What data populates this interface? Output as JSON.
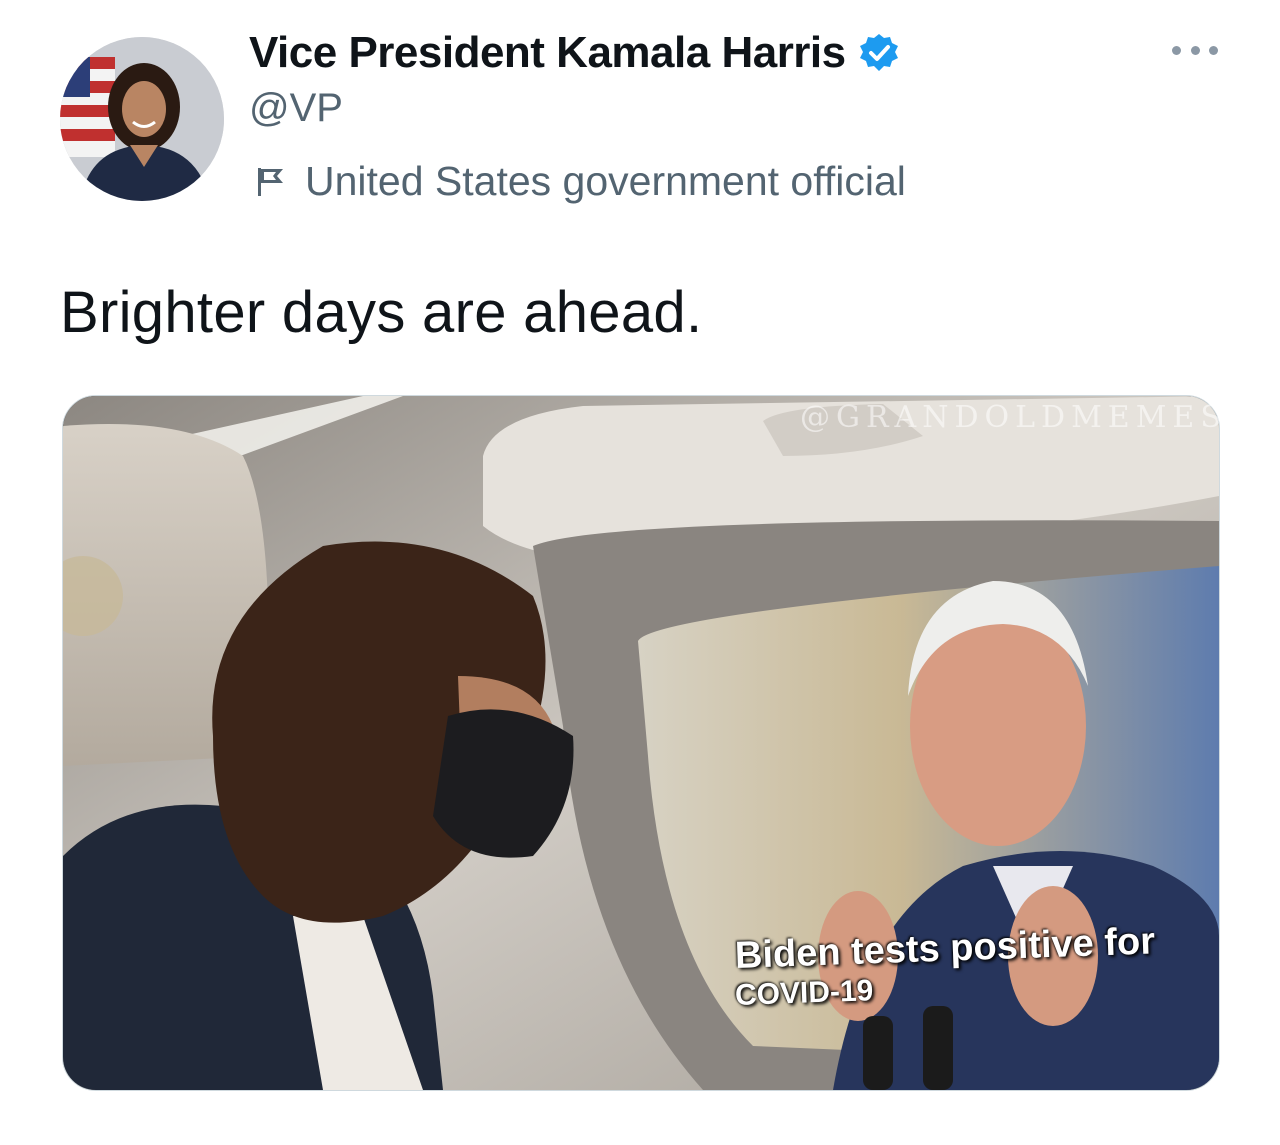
{
  "tweet": {
    "author": {
      "display_name": "Vice President Kamala Harris",
      "handle": "@VP",
      "verified": true,
      "verified_icon": "verified-badge-icon",
      "account_label": "United States government official",
      "label_icon": "flag-icon",
      "avatar_icon": "profile-avatar"
    },
    "more_icon": "more-options-icon",
    "text": "Brighter days are ahead.",
    "media": {
      "watermark": "@GRANDOLDMEMES",
      "caption_line1": "Biden tests positive for",
      "caption_line2": "COVID-19"
    }
  },
  "colors": {
    "verified_blue": "#1d9bf0",
    "secondary_text": "#536471",
    "primary_text": "#0f1419"
  }
}
